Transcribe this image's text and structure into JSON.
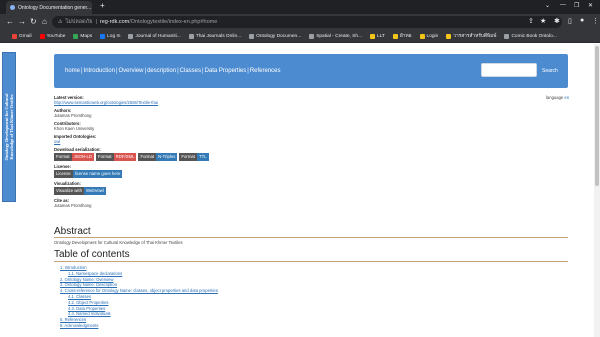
{
  "browser": {
    "tab_title": "Ontology Documentation gener...",
    "url_host": "ไม่ปลอดภัย",
    "url_domain": "reg-rdk.com",
    "url_path": "/Ontologytextile/index-en.php#home",
    "bookmarks": [
      {
        "label": "Gmail",
        "color": "#ea4335"
      },
      {
        "label": "YouTube",
        "color": "#ff0000"
      },
      {
        "label": "Maps",
        "color": "#34a853"
      },
      {
        "label": "Log In",
        "color": "#1877f2"
      },
      {
        "label": "Journal of Humaniti...",
        "color": "#9aa0a6"
      },
      {
        "label": "Thai Journals Onlin...",
        "color": "#9aa0a6"
      },
      {
        "label": "Ontology Documen...",
        "color": "#9aa0a6"
      },
      {
        "label": "Spatial - Create, Sh...",
        "color": "#9aa0a6"
      },
      {
        "label": "LLT",
        "color": "#f5c518"
      },
      {
        "label": "ผ้าทอ",
        "color": "#f5c518"
      },
      {
        "label": "Login",
        "color": "#f5c518"
      },
      {
        "label": "วารสารสำหรับตีพิมพ์",
        "color": "#f5c518"
      },
      {
        "label": "Comic Book Ontolo...",
        "color": "#9aa0a6"
      }
    ]
  },
  "sidebar_banner": {
    "line1": "Ontology Development for Cultural",
    "line2": "Knowledge of Thai Khmer Textiles"
  },
  "nav": {
    "links": [
      "home",
      "Introduction",
      "Overview",
      "description",
      "Classes",
      "Data Properties",
      "References"
    ],
    "search_label": "Search"
  },
  "lang": {
    "label": "language",
    "value": "en"
  },
  "meta": {
    "latest_version_label": "Latest version:",
    "latest_version_url": "http://www.semanticweb.org/ontologies/2566/Textile-thai",
    "authors_label": "Authors:",
    "authors_value": "Jutamas Promthong",
    "contributors_label": "Contributors:",
    "contributors_value": "Khon Kaen University",
    "imported_label": "Imported Ontologies:",
    "imported_value": "owl",
    "download_label": "Download serialization:",
    "formats": [
      {
        "label": "Format",
        "value": "JSON-LD",
        "color": "#d9534f"
      },
      {
        "label": "Format",
        "value": "RDF/XML",
        "color": "#d9534f"
      },
      {
        "label": "Format",
        "value": "N-Triples",
        "color": "#337ab7"
      },
      {
        "label": "Format",
        "value": "TTL",
        "color": "#337ab7"
      }
    ],
    "license_label": "License:",
    "license_badge_l": "License",
    "license_badge_r": "license name goes here",
    "license_color": "#337ab7",
    "visualization_label": "Visualization:",
    "vis_badge_l": "Visualize with",
    "vis_badge_r": "WebVowl",
    "vis_color": "#337ab7",
    "cite_label": "Cite as:",
    "cite_value": "Jutamas Promthong"
  },
  "abstract": {
    "title": "Abstract",
    "text": "Ontology Development for Cultural Knowledge of Thai Khmer Textiles"
  },
  "toc": {
    "title": "Table of contents",
    "items": [
      {
        "text": "1. Introduction",
        "sub": false
      },
      {
        "text": "1.1. Namespace declarations",
        "sub": true
      },
      {
        "text": "2. Ontology Name: Overview",
        "sub": false
      },
      {
        "text": "3. Ontology Name: Description",
        "sub": false
      },
      {
        "text": "4. Cross-reference for Ontology Name: classes, object properties and data properties",
        "sub": false
      },
      {
        "text": "4.1. Classes",
        "sub": true
      },
      {
        "text": "4.2. Object Properties",
        "sub": true
      },
      {
        "text": "4.3. Data Properties",
        "sub": true
      },
      {
        "text": "4.4. Named Individuals",
        "sub": true
      },
      {
        "text": "5. References",
        "sub": false
      },
      {
        "text": "6. Acknowledgments",
        "sub": false
      }
    ]
  }
}
